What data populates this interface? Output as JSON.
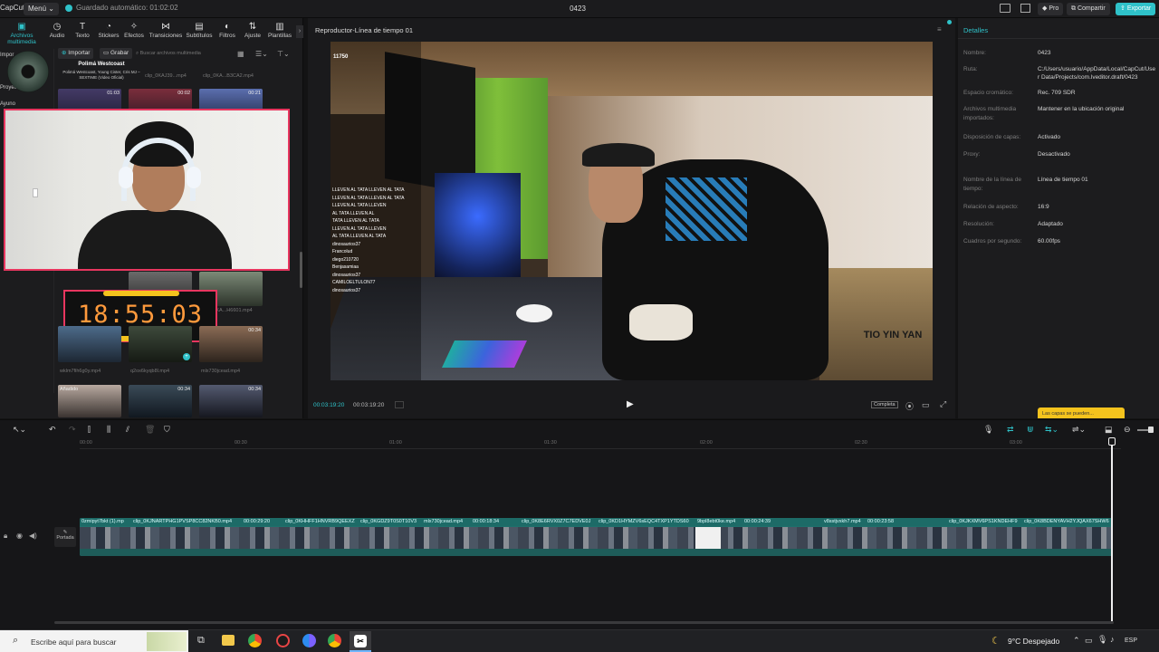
{
  "titlebar": {
    "logo": "CapCut",
    "menu": "Menú",
    "autosave": "Guardado automático: 01:02:02",
    "project_name": "0423",
    "pro": "Pro",
    "share": "Compartir",
    "export": "Exportar"
  },
  "toolbar": {
    "items": [
      {
        "label": "Archivos multimedia",
        "icon": "media-icon"
      },
      {
        "label": "Audio",
        "icon": "audio-icon"
      },
      {
        "label": "Texto",
        "icon": "text-icon"
      },
      {
        "label": "Stickers",
        "icon": "sticker-icon"
      },
      {
        "label": "Efectos",
        "icon": "effects-icon"
      },
      {
        "label": "Transiciones",
        "icon": "transitions-icon"
      },
      {
        "label": "Subtítulos",
        "icon": "subtitles-icon"
      },
      {
        "label": "Filtros",
        "icon": "filters-icon"
      },
      {
        "label": "Ajuste",
        "icon": "adjust-icon"
      },
      {
        "label": "Plantillas",
        "icon": "templates-icon"
      }
    ]
  },
  "media": {
    "import": "Importar",
    "record": "Grabar",
    "search_placeholder": "Buscar archivos multimedia",
    "side_items": [
      "Impor",
      "Proyecto",
      "Ayuno"
    ],
    "now_playing_title": "Polimá Westcoast",
    "now_playing_sub": "Polimá Westcoast, Young Cister, Cris MJ – SEXTIME (Video Oficial)",
    "files": [
      {
        "name": "clip_0KAJ39...mp4",
        "dur": "01:03"
      },
      {
        "name": "clip_0KA...B3CA2.mp4",
        "dur": "00:02"
      },
      {
        "name": "",
        "dur": "00:21"
      },
      {
        "name": "clip_0KA...H6601.mp4",
        "dur": ""
      },
      {
        "name": "wklm7fih6g0y.mp4",
        "dur": ""
      },
      {
        "name": "q2ox6kyqb8l.mp4",
        "dur": ""
      },
      {
        "name": "mlx730jcead.mp4",
        "dur": "00:34"
      },
      {
        "name": "",
        "dur": "00:34"
      },
      {
        "name": "",
        "dur": "00:34"
      }
    ],
    "added_label": "Añadido",
    "clock": "18:55:03"
  },
  "player": {
    "title": "Reproductor-Línea de tiempo 01",
    "current_time": "00:03:19:20",
    "total_time": "00:03:19:20",
    "ratio_btn": "Completa",
    "watermark": "TIO YIN YAN",
    "chat_lines": [
      "LLEVEN AL TATA LLEVEN AL TATA",
      "LLEVEN AL TATA LLEVEN AL TATA",
      "LLEVEN AL TATA LLEVEN",
      "AL TATA LLEVEN AL",
      "TATA LLEVEN AL TATA",
      "LLEVEN AL TATA LLEVEN",
      "AL TATA LLEVEN AL TATA",
      "dinosaurios37",
      "Francolud",
      "diego210720",
      "Benjasamiaa",
      "dinosaurios37",
      "CAMILOELTULON77",
      "dinosaurios37"
    ]
  },
  "details": {
    "title": "Detalles",
    "rows": [
      {
        "k": "Nombre:",
        "v": "0423"
      },
      {
        "k": "Ruta:",
        "v": "C:/Users/usuario/AppData/Local/CapCut/User Data/Projects/com.lveditor.draft/0423"
      },
      {
        "k": "Espacio cromático:",
        "v": "Rec. 709 SDR"
      },
      {
        "k": "Archivos multimedia importados:",
        "v": "Mantener en la ubicación original"
      },
      {
        "k": "Disposición de capas:",
        "v": "Activado"
      },
      {
        "k": "Proxy:",
        "v": "Desactivado"
      },
      {
        "k": "Nombre de la línea de tiempo:",
        "v": "Línea de tiempo 01"
      },
      {
        "k": "Relación de aspecto:",
        "v": "16:9"
      },
      {
        "k": "Resolución:",
        "v": "Adaptado"
      },
      {
        "k": "Cuadros por segundo:",
        "v": "60.00fps"
      }
    ],
    "tooltip": "Las capas se pueden..."
  },
  "timeline": {
    "ticks": [
      "00:00",
      "00:30",
      "01:00",
      "01:30",
      "02:00",
      "02:30",
      "03:00"
    ],
    "track_label": "Portada",
    "clip_labels": [
      "0zmipyt7bkt (1).mp",
      "clip_0KJNARTPHG1PVSP8CC82NKB0.mp4",
      "00:00:29:20",
      "clip_0KHHFF1HNVRB9QEEXZ",
      "clip_0KGDZ9T0S0T10V3",
      "mlx730jcead.mp4",
      "00:00:18:34",
      "clip_0K8E6RVX0Z7C7EDVE0J",
      "clip_0KD1HYMZV6sEQC4TXP1YTDS60",
      "9bpl8ebt0ke.mp4",
      "00:00:24:39",
      "v8sstjvxkh7.mp4",
      "00:00:23:58",
      "clip_0KJKXMV6PS1KNDEHF9",
      "clip_0K8BDENYAVH2YJQAX67SHW6"
    ]
  },
  "taskbar": {
    "search": "Escribe aquí para buscar",
    "weather": "9°C Despejado",
    "lang": "ESP"
  }
}
